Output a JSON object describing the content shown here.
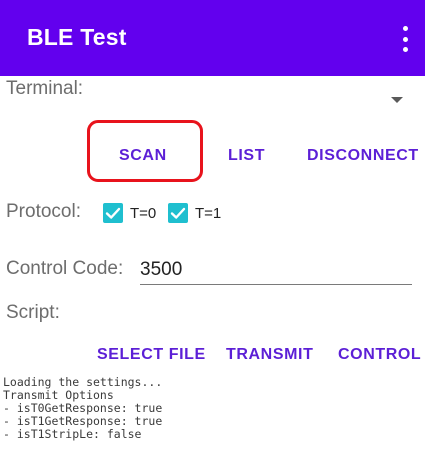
{
  "app_bar": {
    "title": "BLE Test",
    "overflow_icon": "more-vert-icon",
    "background": "#6200ee"
  },
  "terminal": {
    "label": "Terminal:",
    "selected_value": "",
    "dropdown_icon": "arrow-drop-down-icon"
  },
  "actions_row1": {
    "scan_label": "SCAN",
    "list_label": "LIST",
    "disconnect_label": "DISCONNECT",
    "highlight_color": "#e8131c"
  },
  "protocol": {
    "label": "Protocol:",
    "options": [
      {
        "label": "T=0",
        "checked": true
      },
      {
        "label": "T=1",
        "checked": true
      }
    ],
    "check_color": "#1fbfcf"
  },
  "control_code": {
    "label": "Control Code:",
    "value": "3500"
  },
  "script": {
    "label": "Script:"
  },
  "actions_row2": {
    "select_file_label": "SELECT FILE",
    "transmit_label": "TRANSMIT",
    "control_label": "CONTROL"
  },
  "log": {
    "lines": [
      "Loading the settings...",
      "Transmit Options",
      "- isT0GetResponse: true",
      "- isT1GetResponse: true",
      "- isT1StripLe: false"
    ]
  },
  "accent_color": "#5c1fd6"
}
